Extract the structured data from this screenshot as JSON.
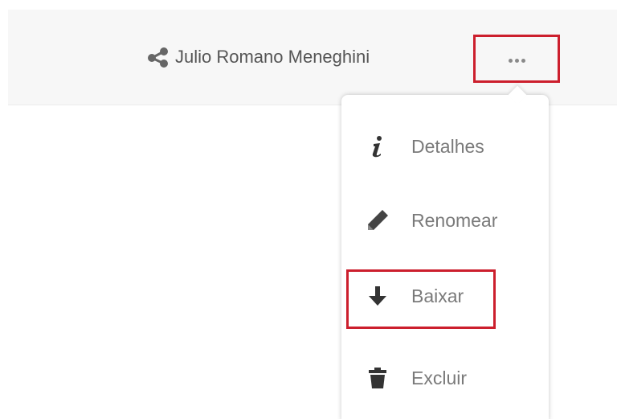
{
  "file_row": {
    "owner_name": "Julio Romano Meneghini",
    "share_icon": "share-icon",
    "more_icon": "more-options-icon"
  },
  "menu": {
    "items": [
      {
        "label": "Detalhes",
        "icon": "info-icon"
      },
      {
        "label": "Renomear",
        "icon": "pencil-icon"
      },
      {
        "label": "Baixar",
        "icon": "download-icon"
      },
      {
        "label": "Excluir",
        "icon": "trash-icon"
      }
    ]
  },
  "colors": {
    "highlight": "#cc1f2d",
    "row_background": "#f7f7f7",
    "menu_text": "#7a7a7a",
    "icon": "#444444"
  }
}
